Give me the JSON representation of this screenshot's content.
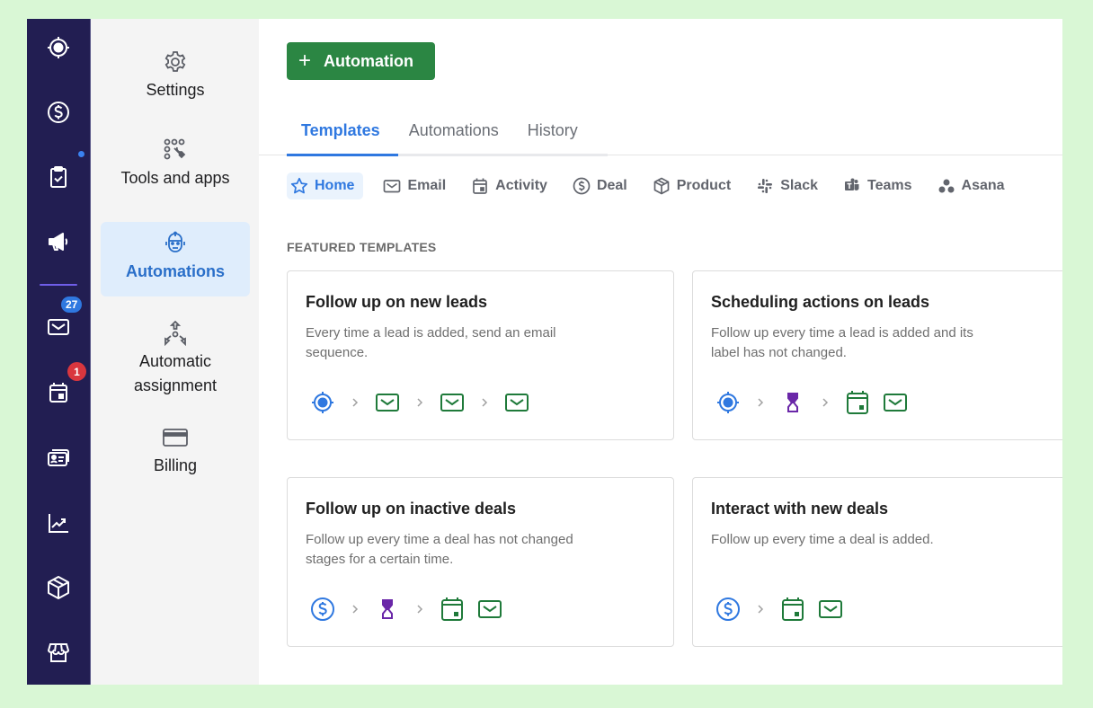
{
  "rail": {
    "items": [
      {
        "name": "leads",
        "icon": "target-icon"
      },
      {
        "name": "deals",
        "icon": "dollar-icon"
      },
      {
        "name": "projects",
        "icon": "clipboard-check-icon"
      },
      {
        "name": "campaigns",
        "icon": "megaphone-icon"
      },
      {
        "name": "mail",
        "icon": "mail-icon",
        "badge": "27"
      },
      {
        "name": "activities",
        "icon": "calendar-icon",
        "badge": "1"
      },
      {
        "name": "contacts",
        "icon": "contact-card-icon"
      },
      {
        "name": "insights",
        "icon": "chart-icon"
      },
      {
        "name": "products",
        "icon": "box-icon"
      },
      {
        "name": "marketplace",
        "icon": "store-icon"
      }
    ],
    "colors": {
      "background": "#221e52",
      "badge_blue": "#2f78e0",
      "badge_red": "#d9363e"
    }
  },
  "settings_panel": {
    "items": [
      {
        "label": "Settings",
        "icon": "gear-icon"
      },
      {
        "label": "Tools and apps",
        "icon": "tools-icon"
      },
      {
        "label": "Automations",
        "icon": "robot-icon",
        "active": true
      },
      {
        "label": "Automatic assignment",
        "icon": "assignment-icon"
      },
      {
        "label": "Billing",
        "icon": "credit-card-icon"
      }
    ]
  },
  "main": {
    "add_button": {
      "plus": "+",
      "label": "Automation",
      "color": "#2b8643"
    },
    "tabs": [
      {
        "label": "Templates",
        "active": true
      },
      {
        "label": "Automations"
      },
      {
        "label": "History"
      }
    ],
    "filters": [
      {
        "label": "Home",
        "icon": "star-icon",
        "active": true
      },
      {
        "label": "Email",
        "icon": "mail-icon"
      },
      {
        "label": "Activity",
        "icon": "calendar-icon"
      },
      {
        "label": "Deal",
        "icon": "dollar-icon"
      },
      {
        "label": "Product",
        "icon": "box-icon"
      },
      {
        "label": "Slack",
        "icon": "slack-icon"
      },
      {
        "label": "Teams",
        "icon": "teams-icon"
      },
      {
        "label": "Asana",
        "icon": "asana-icon"
      }
    ],
    "section_title": "FEATURED TEMPLATES",
    "templates": [
      {
        "title": "Follow up on new leads",
        "description": "Every time a lead is added, send an email sequence.",
        "steps": [
          "lead",
          ">",
          "email",
          ">",
          "email",
          ">",
          "email"
        ]
      },
      {
        "title": "Scheduling actions on leads",
        "description": "Follow up every time a lead is added and its label has not changed.",
        "steps": [
          "lead",
          ">",
          "wait",
          ">",
          "activity",
          "email"
        ]
      },
      {
        "title": "Follow up on inactive deals",
        "description": "Follow up every time a deal has not changed stages for a certain time.",
        "steps": [
          "deal",
          ">",
          "wait",
          ">",
          "activity",
          "email"
        ]
      },
      {
        "title": "Interact with new deals",
        "description": "Follow up every time a deal is added.",
        "steps": [
          "deal",
          ">",
          "activity",
          "email"
        ]
      }
    ],
    "colors": {
      "accent": "#2f78e0",
      "trigger_blue": "#2f78e0",
      "action_green": "#1f7a3a",
      "wait_purple": "#6a27a8"
    }
  }
}
